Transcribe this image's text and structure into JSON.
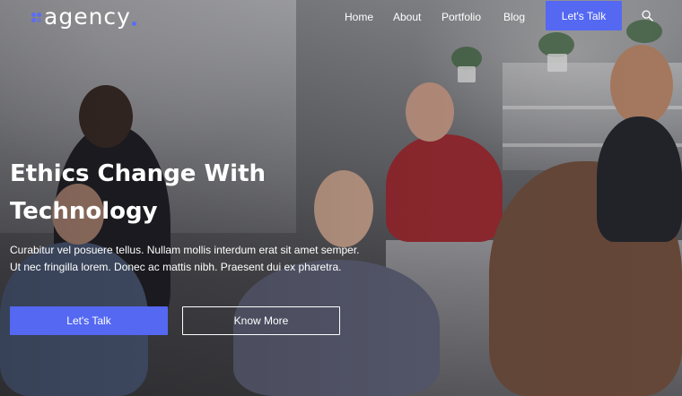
{
  "header": {
    "logo_text": "agency",
    "nav": [
      {
        "label": "Home"
      },
      {
        "label": "About"
      },
      {
        "label": "Portfolio"
      },
      {
        "label": "Blog"
      }
    ],
    "cta_label": "Let's Talk",
    "search_icon": "search-icon"
  },
  "hero": {
    "title_line1": "Ethics Change With",
    "title_line2": "Technology",
    "desc_line1": "Curabitur vel posuere tellus. Nullam mollis interdum erat sit amet semper.",
    "desc_line2": "Ut nec fringilla lorem. Donec ac mattis nibh. Praesent dui ex pharetra.",
    "primary_button": "Let's Talk",
    "secondary_button": "Know More"
  },
  "colors": {
    "accent": "#5468f2",
    "text": "#ffffff"
  }
}
